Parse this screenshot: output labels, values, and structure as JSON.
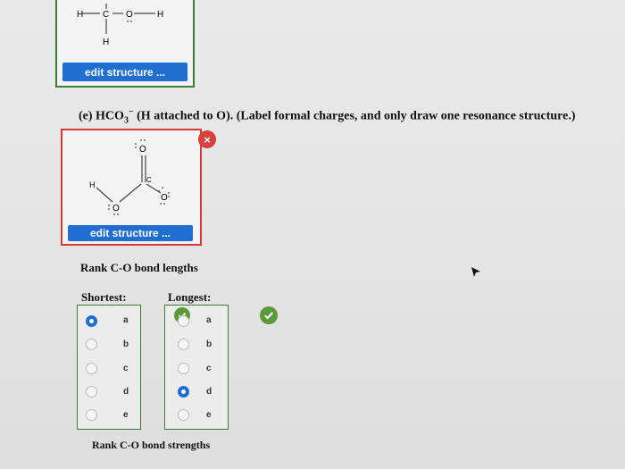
{
  "top_structure": {
    "atom_h_left": "H",
    "atom_c": "C",
    "atom_o": "O",
    "atom_h_right": "H",
    "atom_h_bottom": "H",
    "edit_label": "edit structure ..."
  },
  "question": {
    "prefix": "(e) HCO",
    "subscript": "3",
    "superscript": "−",
    "text": " (H attached to O). (Label formal charges, and only draw one resonance structure.)"
  },
  "structure_e": {
    "atom_o_top": "O",
    "atom_c": "C",
    "atom_h": "H",
    "atom_o_left": "O",
    "atom_o_right": "O",
    "edit_label": "edit structure ...",
    "error_mark": "×"
  },
  "rank_lengths": {
    "title": "Rank C-O bond lengths",
    "shortest_label": "Shortest:",
    "longest_label": "Longest:",
    "options": [
      "a",
      "b",
      "c",
      "d",
      "e"
    ],
    "shortest_selected": "a",
    "longest_selected": "d"
  },
  "rank_strengths": {
    "title": "Rank C-O bond strengths"
  },
  "colors": {
    "accent": "#1f6fd3",
    "correct": "#5a9a3a",
    "error": "#d33a3a",
    "box_correct": "#3d7a3d"
  }
}
